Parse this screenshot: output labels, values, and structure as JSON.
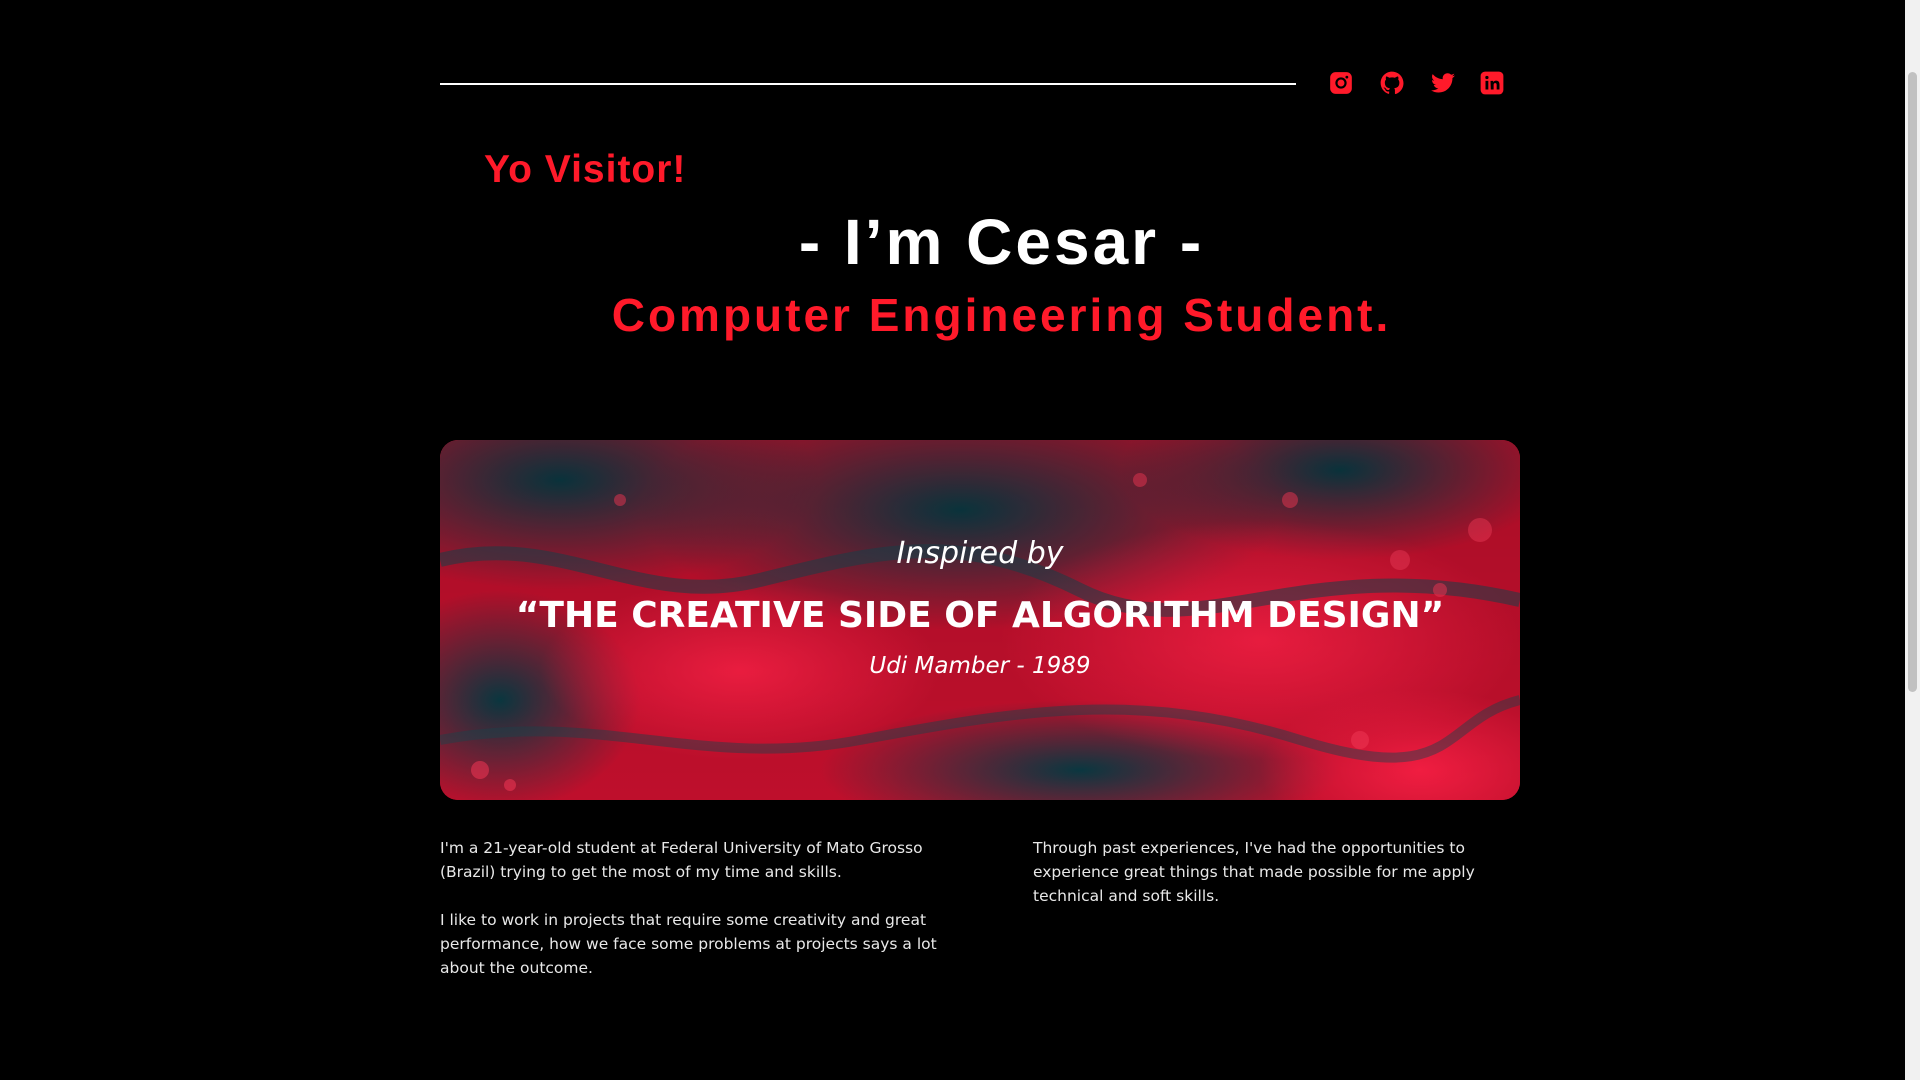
{
  "header": {
    "social": [
      {
        "name": "instagram-icon"
      },
      {
        "name": "github-icon"
      },
      {
        "name": "twitter-icon"
      },
      {
        "name": "linkedin-icon"
      }
    ],
    "icon_color": "#ff1a2a"
  },
  "hero": {
    "greeting": "Yo Visitor!",
    "name": "- I’m Cesar -",
    "role": "Computer Engineering Student."
  },
  "banner": {
    "intro": "Inspired by",
    "quote": "“THE CREATIVE SIDE OF ALGORITHM DESIGN”",
    "author": "Udi Mamber - 1989"
  },
  "about": {
    "left": [
      "I'm a 21-year-old student at Federal University of Mato Grosso (Brazil) trying to get the most of my time and skills.",
      "I like to work in projects that require some creativity and great performance, how we face some problems at projects says a lot about the outcome."
    ],
    "right": [
      "Through past experiences, I've had the opportunities to experience great things that made possible for me apply technical and soft skills."
    ]
  },
  "colors": {
    "accent": "#ff1a2a",
    "background": "#000000",
    "text": "#ffffff"
  }
}
